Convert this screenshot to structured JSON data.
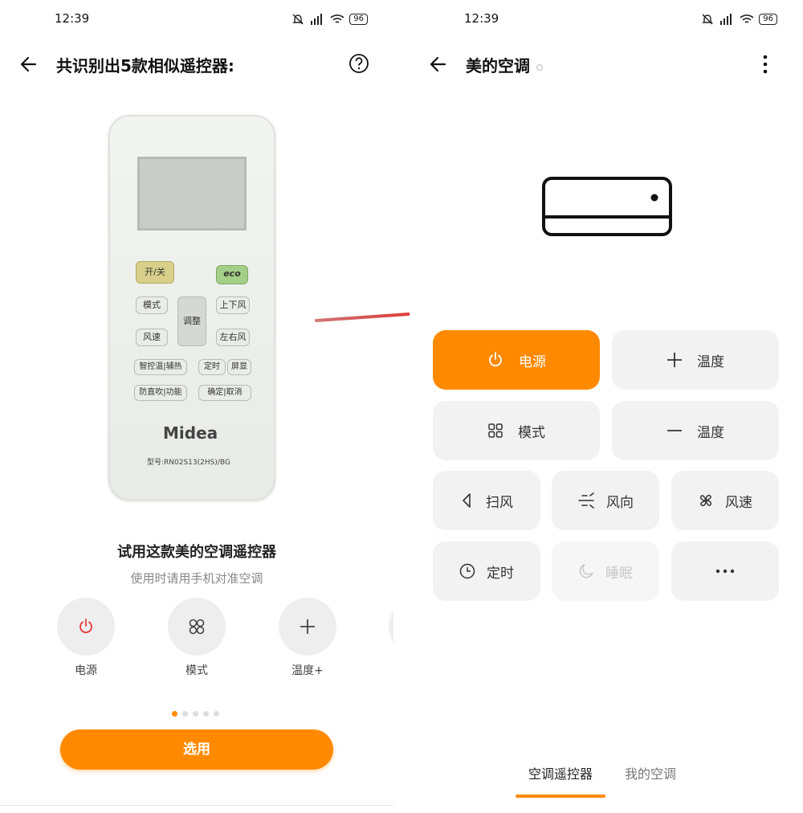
{
  "colors": {
    "accent": "#ff8a00",
    "tile_bg": "#f2f2f2",
    "power_red": "#e53935"
  },
  "left": {
    "status": {
      "time": "12:39",
      "battery": "96"
    },
    "title": "共识别出5款相似遥控器:",
    "remote": {
      "buttons": {
        "power": "开/关",
        "eco": "eco",
        "mode": "模式",
        "adjust": "调整",
        "updown": "上下风",
        "speed": "风速",
        "leftright": "左右风",
        "smart": "智控温|辅热",
        "timer": "定时",
        "display": "屏显",
        "antiblow": "防直吹|功能",
        "confirm": "确定|取消"
      },
      "brand": "Midea",
      "model": "型号:RN02S13(2HS)/BG"
    },
    "heading": "试用这款美的空调遥控器",
    "subheading": "使用时请用手机对准空调",
    "buttons": [
      {
        "label": "电源",
        "icon": "power-icon"
      },
      {
        "label": "模式",
        "icon": "grid-icon"
      },
      {
        "label": "温度+",
        "icon": "plus-icon"
      }
    ],
    "pagination": {
      "total": 5,
      "current": 1
    },
    "apply_label": "选用"
  },
  "right": {
    "status": {
      "time": "12:39",
      "battery": "96"
    },
    "title": "美的空调",
    "tiles": {
      "power": "电源",
      "temp_up": "温度",
      "mode": "模式",
      "temp_down": "温度",
      "swing": "扫风",
      "direction": "风向",
      "speed": "风速",
      "timer": "定时",
      "sleep": "睡眠"
    },
    "tabs": {
      "remote": "空调遥控器",
      "mine": "我的空调"
    }
  }
}
